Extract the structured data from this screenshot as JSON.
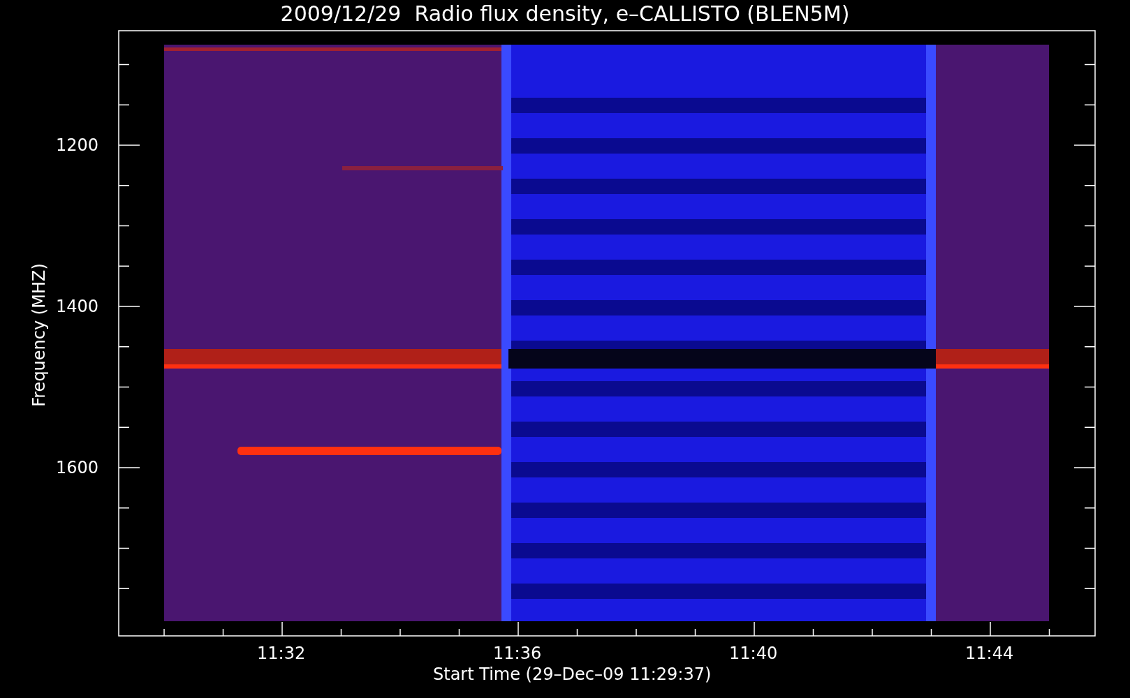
{
  "title": "2009/12/29  Radio flux density, e–CALLISTO (BLEN5M)",
  "axes": {
    "ylabel": "Frequency (MHZ)",
    "xlabel": "Start Time (29–Dec–09 11:29:37)",
    "yticks": [
      "1200",
      "1400",
      "1600"
    ],
    "xticks": [
      "11:32",
      "11:36",
      "11:40",
      "11:44"
    ]
  }
}
